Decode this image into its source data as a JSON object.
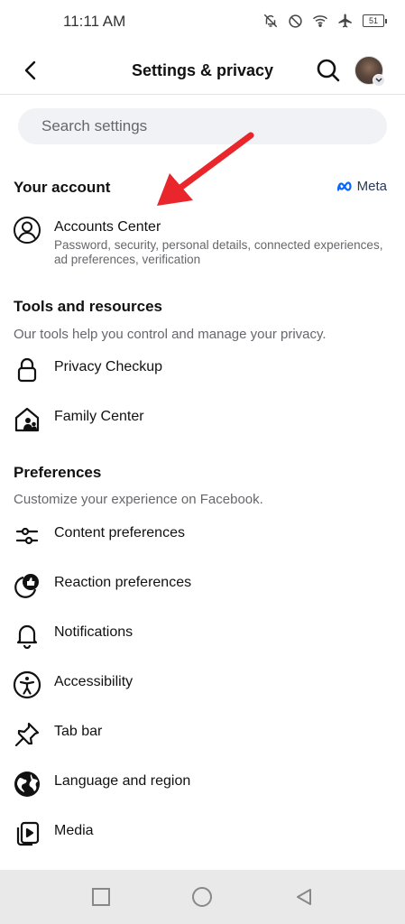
{
  "status_bar": {
    "time": "11:11 AM",
    "battery_level": "51",
    "icons": [
      "silent-bell-icon",
      "do-not-disturb-icon",
      "wifi-icon",
      "airplane-icon",
      "battery-icon"
    ]
  },
  "header": {
    "title": "Settings & privacy",
    "back_icon": "back-arrow-icon",
    "search_icon": "search-icon"
  },
  "search": {
    "placeholder": "Search settings"
  },
  "your_account": {
    "title": "Your account",
    "brand": "Meta",
    "item": {
      "label": "Accounts Center",
      "description": "Password, security, personal details, connected experiences, ad preferences, verification",
      "icon": "account-circle-icon"
    }
  },
  "tools": {
    "title": "Tools and resources",
    "subtitle": "Our tools help you control and manage your privacy.",
    "items": [
      {
        "label": "Privacy Checkup",
        "icon": "lock-icon"
      },
      {
        "label": "Family Center",
        "icon": "family-house-icon"
      }
    ]
  },
  "preferences": {
    "title": "Preferences",
    "subtitle": "Customize your experience on Facebook.",
    "items": [
      {
        "label": "Content preferences",
        "icon": "sliders-icon"
      },
      {
        "label": "Reaction preferences",
        "icon": "reaction-like-icon"
      },
      {
        "label": "Notifications",
        "icon": "bell-icon"
      },
      {
        "label": "Accessibility",
        "icon": "accessibility-icon"
      },
      {
        "label": "Tab bar",
        "icon": "pin-icon"
      },
      {
        "label": "Language and region",
        "icon": "globe-icon"
      },
      {
        "label": "Media",
        "icon": "media-play-icon"
      }
    ]
  },
  "annotation": {
    "arrow_color": "#e8262b"
  },
  "nav_bar": {
    "icons": [
      "recent-apps-icon",
      "home-icon",
      "back-triangle-icon"
    ]
  }
}
